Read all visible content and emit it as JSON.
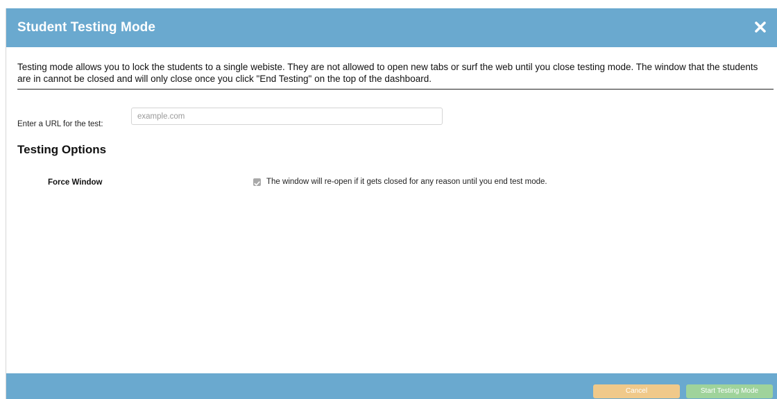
{
  "header": {
    "title": "Student Testing Mode",
    "close_icon": "close-icon",
    "bg_color": "#6aa9cf"
  },
  "intro": {
    "text": "Testing mode allows you to lock the students to a single webiste. They are not allowed to open new tabs or surf the web until you close testing mode. The window that the students are in cannot be closed and will only close once you click \"End Testing\" on the top of the dashboard."
  },
  "url_field": {
    "label": "Enter a URL for the test:",
    "placeholder": "example.com",
    "value": ""
  },
  "options": {
    "title": "Testing Options",
    "items": [
      {
        "label": "Force Window",
        "checked": true,
        "description": "The window will re-open if it gets closed for any reason until you end test mode."
      }
    ]
  },
  "footer": {
    "cancel_label": "Cancel",
    "start_label": "Start Testing Mode",
    "cancel_color": "#f0c98a",
    "start_color": "#9fd39b"
  }
}
